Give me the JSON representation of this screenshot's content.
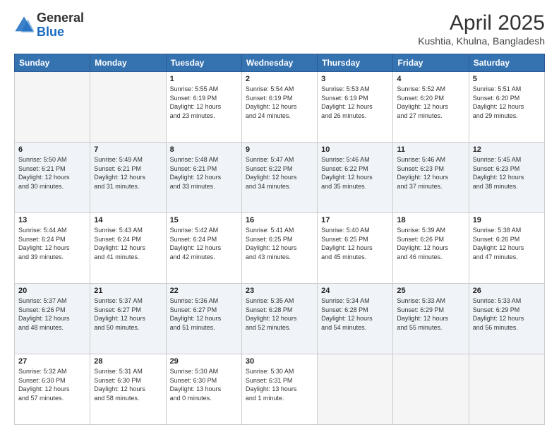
{
  "header": {
    "logo": {
      "line1": "General",
      "line2": "Blue"
    },
    "title": "April 2025",
    "subtitle": "Kushtia, Khulna, Bangladesh"
  },
  "weekdays": [
    "Sunday",
    "Monday",
    "Tuesday",
    "Wednesday",
    "Thursday",
    "Friday",
    "Saturday"
  ],
  "weeks": [
    [
      {
        "day": "",
        "info": ""
      },
      {
        "day": "",
        "info": ""
      },
      {
        "day": "1",
        "info": "Sunrise: 5:55 AM\nSunset: 6:19 PM\nDaylight: 12 hours\nand 23 minutes."
      },
      {
        "day": "2",
        "info": "Sunrise: 5:54 AM\nSunset: 6:19 PM\nDaylight: 12 hours\nand 24 minutes."
      },
      {
        "day": "3",
        "info": "Sunrise: 5:53 AM\nSunset: 6:19 PM\nDaylight: 12 hours\nand 26 minutes."
      },
      {
        "day": "4",
        "info": "Sunrise: 5:52 AM\nSunset: 6:20 PM\nDaylight: 12 hours\nand 27 minutes."
      },
      {
        "day": "5",
        "info": "Sunrise: 5:51 AM\nSunset: 6:20 PM\nDaylight: 12 hours\nand 29 minutes."
      }
    ],
    [
      {
        "day": "6",
        "info": "Sunrise: 5:50 AM\nSunset: 6:21 PM\nDaylight: 12 hours\nand 30 minutes."
      },
      {
        "day": "7",
        "info": "Sunrise: 5:49 AM\nSunset: 6:21 PM\nDaylight: 12 hours\nand 31 minutes."
      },
      {
        "day": "8",
        "info": "Sunrise: 5:48 AM\nSunset: 6:21 PM\nDaylight: 12 hours\nand 33 minutes."
      },
      {
        "day": "9",
        "info": "Sunrise: 5:47 AM\nSunset: 6:22 PM\nDaylight: 12 hours\nand 34 minutes."
      },
      {
        "day": "10",
        "info": "Sunrise: 5:46 AM\nSunset: 6:22 PM\nDaylight: 12 hours\nand 35 minutes."
      },
      {
        "day": "11",
        "info": "Sunrise: 5:46 AM\nSunset: 6:23 PM\nDaylight: 12 hours\nand 37 minutes."
      },
      {
        "day": "12",
        "info": "Sunrise: 5:45 AM\nSunset: 6:23 PM\nDaylight: 12 hours\nand 38 minutes."
      }
    ],
    [
      {
        "day": "13",
        "info": "Sunrise: 5:44 AM\nSunset: 6:24 PM\nDaylight: 12 hours\nand 39 minutes."
      },
      {
        "day": "14",
        "info": "Sunrise: 5:43 AM\nSunset: 6:24 PM\nDaylight: 12 hours\nand 41 minutes."
      },
      {
        "day": "15",
        "info": "Sunrise: 5:42 AM\nSunset: 6:24 PM\nDaylight: 12 hours\nand 42 minutes."
      },
      {
        "day": "16",
        "info": "Sunrise: 5:41 AM\nSunset: 6:25 PM\nDaylight: 12 hours\nand 43 minutes."
      },
      {
        "day": "17",
        "info": "Sunrise: 5:40 AM\nSunset: 6:25 PM\nDaylight: 12 hours\nand 45 minutes."
      },
      {
        "day": "18",
        "info": "Sunrise: 5:39 AM\nSunset: 6:26 PM\nDaylight: 12 hours\nand 46 minutes."
      },
      {
        "day": "19",
        "info": "Sunrise: 5:38 AM\nSunset: 6:26 PM\nDaylight: 12 hours\nand 47 minutes."
      }
    ],
    [
      {
        "day": "20",
        "info": "Sunrise: 5:37 AM\nSunset: 6:26 PM\nDaylight: 12 hours\nand 48 minutes."
      },
      {
        "day": "21",
        "info": "Sunrise: 5:37 AM\nSunset: 6:27 PM\nDaylight: 12 hours\nand 50 minutes."
      },
      {
        "day": "22",
        "info": "Sunrise: 5:36 AM\nSunset: 6:27 PM\nDaylight: 12 hours\nand 51 minutes."
      },
      {
        "day": "23",
        "info": "Sunrise: 5:35 AM\nSunset: 6:28 PM\nDaylight: 12 hours\nand 52 minutes."
      },
      {
        "day": "24",
        "info": "Sunrise: 5:34 AM\nSunset: 6:28 PM\nDaylight: 12 hours\nand 54 minutes."
      },
      {
        "day": "25",
        "info": "Sunrise: 5:33 AM\nSunset: 6:29 PM\nDaylight: 12 hours\nand 55 minutes."
      },
      {
        "day": "26",
        "info": "Sunrise: 5:33 AM\nSunset: 6:29 PM\nDaylight: 12 hours\nand 56 minutes."
      }
    ],
    [
      {
        "day": "27",
        "info": "Sunrise: 5:32 AM\nSunset: 6:30 PM\nDaylight: 12 hours\nand 57 minutes."
      },
      {
        "day": "28",
        "info": "Sunrise: 5:31 AM\nSunset: 6:30 PM\nDaylight: 12 hours\nand 58 minutes."
      },
      {
        "day": "29",
        "info": "Sunrise: 5:30 AM\nSunset: 6:30 PM\nDaylight: 13 hours\nand 0 minutes."
      },
      {
        "day": "30",
        "info": "Sunrise: 5:30 AM\nSunset: 6:31 PM\nDaylight: 13 hours\nand 1 minute."
      },
      {
        "day": "",
        "info": ""
      },
      {
        "day": "",
        "info": ""
      },
      {
        "day": "",
        "info": ""
      }
    ]
  ]
}
